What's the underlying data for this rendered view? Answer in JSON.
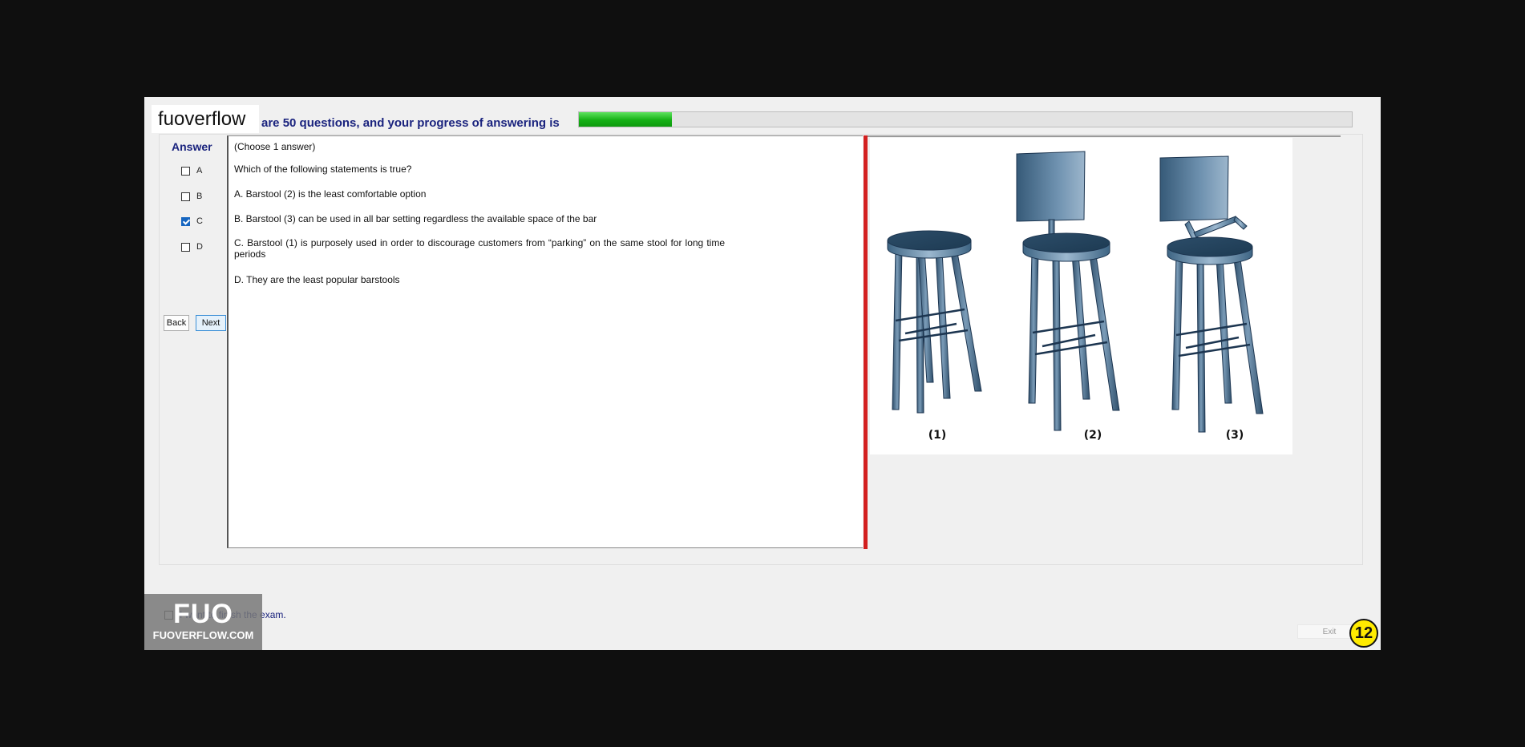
{
  "header": {
    "brand": "fuoverflow",
    "progress_text": "are 50 questions, and your progress of answering is",
    "progress_fraction": 0.12
  },
  "answer": {
    "label": "Answer",
    "options": [
      {
        "letter": "A",
        "checked": false
      },
      {
        "letter": "B",
        "checked": false
      },
      {
        "letter": "C",
        "checked": true
      },
      {
        "letter": "D",
        "checked": false
      }
    ]
  },
  "nav": {
    "back_label": "Back",
    "next_label": "Next"
  },
  "question": {
    "instruction": "(Choose 1 answer)",
    "prompt": "Which of the following statements is true?",
    "choices": [
      "A.  Barstool (2) is the least comfortable option",
      "B.  Barstool (3) can be used in all bar setting regardless the available space of the bar",
      "C.  Barstool (1) is purposely used in order to discourage customers from “parking” on the same stool for long time periods",
      "D.  They are the least popular barstools"
    ]
  },
  "figure": {
    "labels": [
      "(1)",
      "(2)",
      "(3)"
    ]
  },
  "footer": {
    "finish_label": "I want to finish the exam.",
    "exit_label": "Exit",
    "page_number": "12"
  },
  "watermark": {
    "big": "FUO",
    "small": "FUOVERFLOW.COM"
  },
  "colors": {
    "progress": "#15b015",
    "divider": "#d32020",
    "heading": "#1a237e",
    "badge": "#ffeb00"
  }
}
